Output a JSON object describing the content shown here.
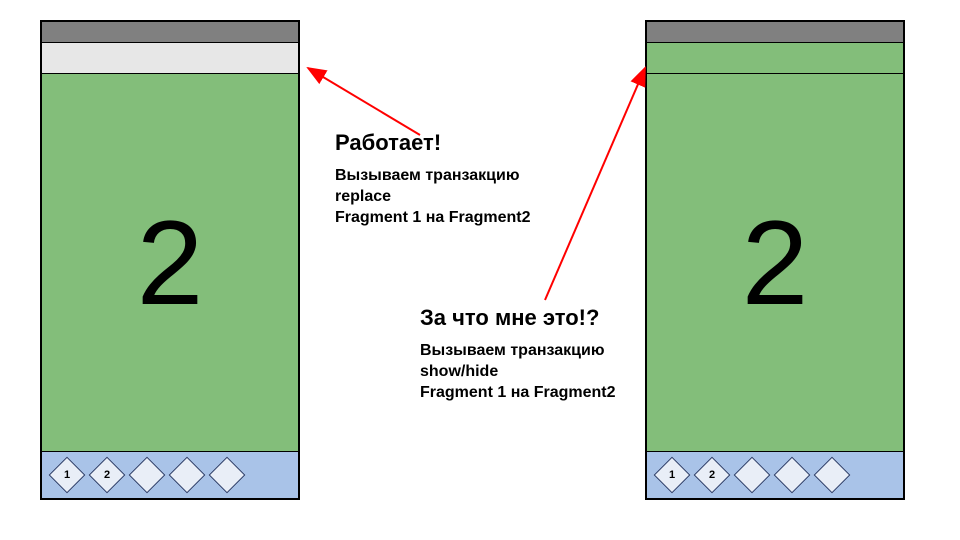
{
  "left_phone": {
    "titlebar_style": "grey",
    "content_number": "2",
    "nav_items": [
      "1",
      "2",
      "",
      "",
      ""
    ]
  },
  "right_phone": {
    "titlebar_style": "green",
    "content_number": "2",
    "nav_items": [
      "1",
      "2",
      "",
      "",
      ""
    ]
  },
  "annotation_top": {
    "heading": "Работает!",
    "body": "Вызываем транзакцию\nreplace\nFragment 1 на Fragment2"
  },
  "annotation_bottom": {
    "heading": "За что мне это!?",
    "body": "Вызываем транзакцию\nshow/hide\nFragment 1 на Fragment2"
  },
  "colors": {
    "green": "#83be7a",
    "nav_blue": "#a9c3e8",
    "status_grey": "#808080",
    "arrow_red": "#ff0000"
  }
}
